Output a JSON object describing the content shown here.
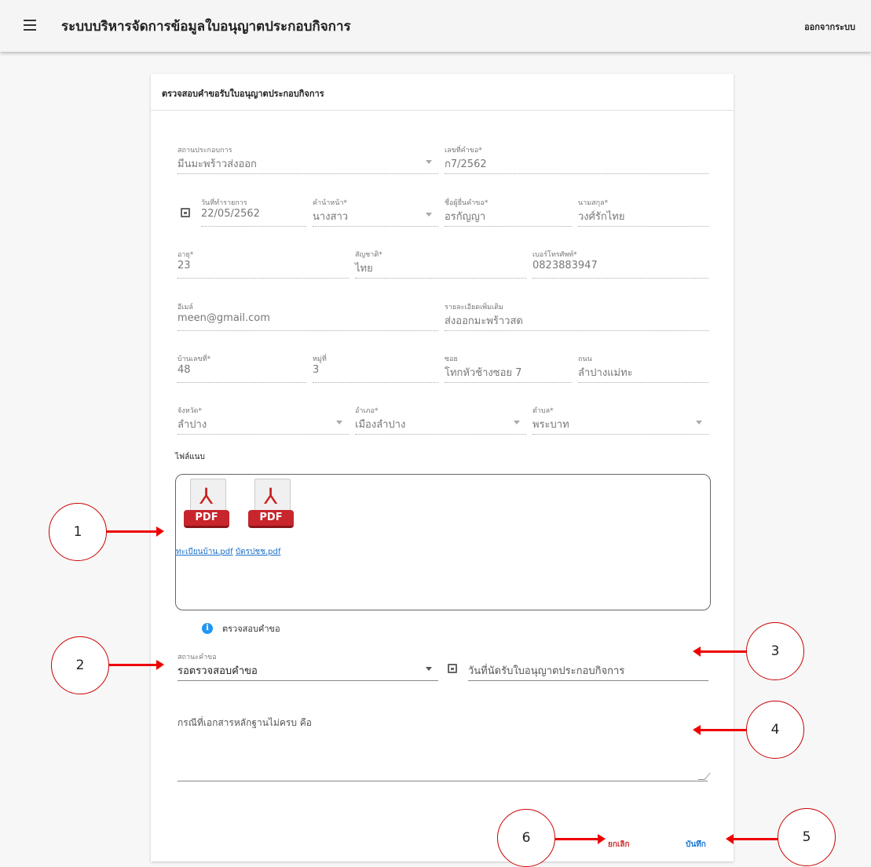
{
  "appbar": {
    "title": "ระบบบริหารจัดการข้อมูลใบอนุญาตประกอบกิจการ",
    "logout": "ออกจากระบบ",
    "menu_icon": "hamburger-menu-icon"
  },
  "card": {
    "title": "ตรวจสอบคำขอรับใบอนุญาตประกอบกิจการ"
  },
  "fields": {
    "business": {
      "label": "สถานประกอบการ",
      "value": "มีนมะพร้าวส่งออก"
    },
    "request_no": {
      "label": "เลขที่คำขอ*",
      "value": "ก7/2562"
    },
    "date": {
      "label": "วันที่ทำรายการ",
      "value": "22/05/2562"
    },
    "prefix": {
      "label": "คำนำหน้า*",
      "value": "นางสาว"
    },
    "first_name": {
      "label": "ชื่อผู้ยื่นคำขอ*",
      "value": "อรกัญญา"
    },
    "last_name": {
      "label": "นามสกุล*",
      "value": "วงศ์รักไทย"
    },
    "age": {
      "label": "อายุ*",
      "value": "23"
    },
    "nationality": {
      "label": "สัญชาติ*",
      "value": "ไทย"
    },
    "phone": {
      "label": "เบอร์โทรศัพท์*",
      "value": "0823883947"
    },
    "email": {
      "label": "อีเมล์",
      "value": "meen@gmail.com"
    },
    "details": {
      "label": "รายละเอียดเพิ่มเติม",
      "value": "ส่งออกมะพร้าวสด"
    },
    "house_no": {
      "label": "บ้านเลขที่*",
      "value": "48"
    },
    "moo": {
      "label": "หมู่ที่",
      "value": "3"
    },
    "soi": {
      "label": "ซอย",
      "value": "โทกหัวช้างซอย 7"
    },
    "road": {
      "label": "ถนน",
      "value": "ลำปางแม่ทะ"
    },
    "province": {
      "label": "จังหวัด*",
      "value": "ลำปาง"
    },
    "district": {
      "label": "อำเภอ*",
      "value": "เมืองลำปาง"
    },
    "subdistrict": {
      "label": "ตำบล*",
      "value": "พระบาท"
    }
  },
  "attachments": {
    "label": "ไฟล์แนบ",
    "files": [
      {
        "name": "ทะเบียนบ้าน.pdf",
        "icon": "pdf-file-icon",
        "tag": "PDF"
      },
      {
        "name": "บัตรปชช.pdf",
        "icon": "pdf-file-icon",
        "tag": "PDF"
      }
    ]
  },
  "review": {
    "heading": "ตรวจสอบคำขอ",
    "status_label": "สถานะคำขอ",
    "status_value": "รอตรวจสอบคำขอ",
    "appointment_placeholder": "วันที่นัดรับใบอนุญาตประกอบกิจการ",
    "incomplete_placeholder": "กรณีที่เอกสารหลักฐานไม่ครบ คือ"
  },
  "buttons": {
    "cancel": "ยกเลิก",
    "save": "บันทึก"
  },
  "callouts": [
    "1",
    "2",
    "3",
    "4",
    "5",
    "6"
  ],
  "colors": {
    "arrow": "#e00000",
    "link": "#1a6fc9",
    "cancel": "#d32f2f",
    "save": "#1976d2",
    "info": "#2196f3",
    "pdf": "#c8252c"
  }
}
